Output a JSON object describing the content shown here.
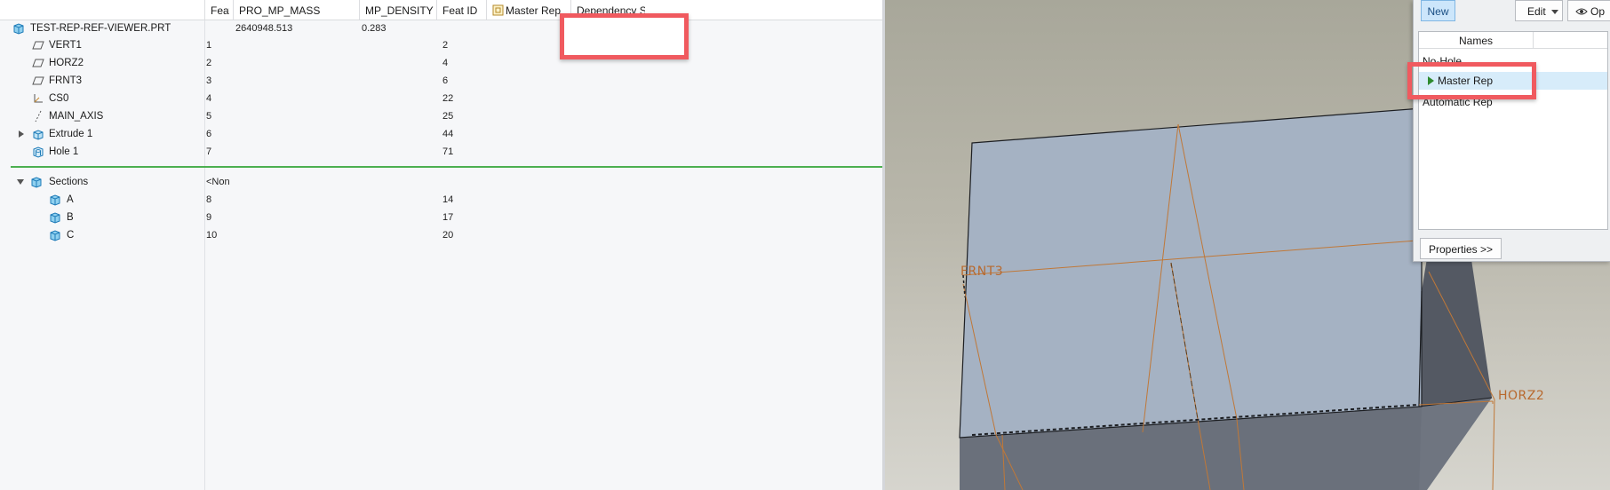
{
  "tree": {
    "columns": [
      {
        "key": "feat",
        "label": "Feat"
      },
      {
        "key": "mass",
        "label": "PRO_MP_MASS"
      },
      {
        "key": "density",
        "label": "MP_DENSITY"
      },
      {
        "key": "featid",
        "label": "Feat ID"
      },
      {
        "key": "masterrep",
        "label": "Master Rep"
      },
      {
        "key": "dependency",
        "label": "Dependency S"
      }
    ],
    "root": {
      "name": "TEST-REP-REF-VIEWER.PRT",
      "mass": "2640948.513",
      "density": "0.283"
    },
    "features": [
      {
        "name": "VERT1",
        "feat": "1",
        "id": "2",
        "icon": "datum-plane-icon"
      },
      {
        "name": "HORZ2",
        "feat": "2",
        "id": "4",
        "icon": "datum-plane-icon"
      },
      {
        "name": "FRNT3",
        "feat": "3",
        "id": "6",
        "icon": "datum-plane-icon"
      },
      {
        "name": "CS0",
        "feat": "4",
        "id": "22",
        "icon": "coordinate-system-icon"
      },
      {
        "name": "MAIN_AXIS",
        "feat": "5",
        "id": "25",
        "icon": "datum-axis-icon"
      },
      {
        "name": "Extrude 1",
        "feat": "6",
        "id": "44",
        "icon": "extrude-icon"
      },
      {
        "name": "Hole 1",
        "feat": "7",
        "id": "71",
        "icon": "hole-icon"
      }
    ],
    "sections": {
      "name": "Sections",
      "feat": "<Non",
      "items": [
        {
          "name": "A",
          "feat": "8",
          "id": "14"
        },
        {
          "name": "B",
          "feat": "9",
          "id": "17"
        },
        {
          "name": "C",
          "feat": "10",
          "id": "20"
        }
      ]
    }
  },
  "graphics": {
    "labels": {
      "frnt": "FRNT3",
      "horz": "HORZ2"
    },
    "colors": {
      "top_face": "#a5b2c3",
      "front_face": "#6f7580",
      "side_face": "#545963",
      "datum": "#c07838"
    }
  },
  "rep_dialog": {
    "new_label": "New",
    "edit_label": "Edit",
    "options_label": "Op",
    "names_header": "Names",
    "items": [
      "No-Hole",
      "Master Rep",
      "Automatic Rep"
    ],
    "properties_label": "Properties >>"
  },
  "colors": {
    "highlight": "#f05a5f",
    "accent": "#4caf50"
  }
}
